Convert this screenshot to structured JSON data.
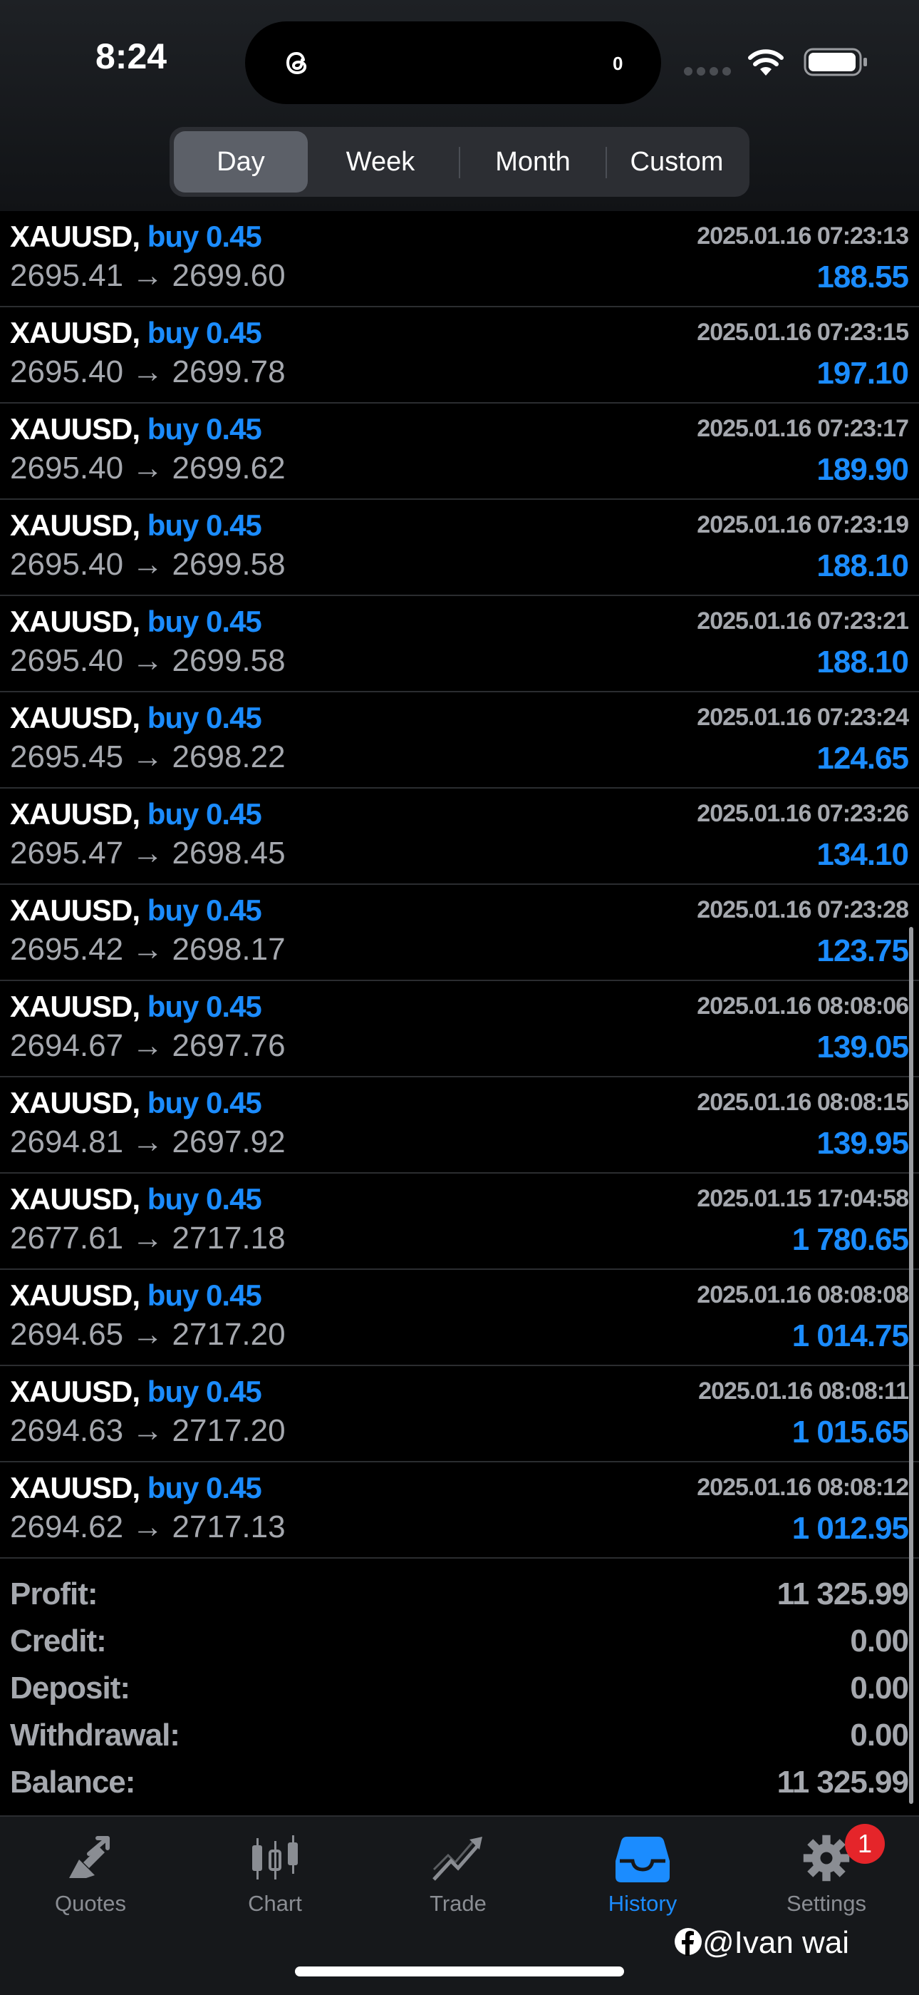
{
  "status_bar": {
    "time": "8:24",
    "island_count": "0"
  },
  "period_tabs": [
    {
      "label": "Day",
      "active": true
    },
    {
      "label": "Week",
      "active": false
    },
    {
      "label": "Month",
      "active": false
    },
    {
      "label": "Custom",
      "active": false
    }
  ],
  "deals": [
    {
      "symbol": "XAUUSD,",
      "action": "buy 0.45",
      "open": "2695.41",
      "close": "2699.60",
      "time": "2025.01.16 07:23:13",
      "profit": "188.55"
    },
    {
      "symbol": "XAUUSD,",
      "action": "buy 0.45",
      "open": "2695.40",
      "close": "2699.78",
      "time": "2025.01.16 07:23:15",
      "profit": "197.10"
    },
    {
      "symbol": "XAUUSD,",
      "action": "buy 0.45",
      "open": "2695.40",
      "close": "2699.62",
      "time": "2025.01.16 07:23:17",
      "profit": "189.90"
    },
    {
      "symbol": "XAUUSD,",
      "action": "buy 0.45",
      "open": "2695.40",
      "close": "2699.58",
      "time": "2025.01.16 07:23:19",
      "profit": "188.10"
    },
    {
      "symbol": "XAUUSD,",
      "action": "buy 0.45",
      "open": "2695.40",
      "close": "2699.58",
      "time": "2025.01.16 07:23:21",
      "profit": "188.10"
    },
    {
      "symbol": "XAUUSD,",
      "action": "buy 0.45",
      "open": "2695.45",
      "close": "2698.22",
      "time": "2025.01.16 07:23:24",
      "profit": "124.65"
    },
    {
      "symbol": "XAUUSD,",
      "action": "buy 0.45",
      "open": "2695.47",
      "close": "2698.45",
      "time": "2025.01.16 07:23:26",
      "profit": "134.10"
    },
    {
      "symbol": "XAUUSD,",
      "action": "buy 0.45",
      "open": "2695.42",
      "close": "2698.17",
      "time": "2025.01.16 07:23:28",
      "profit": "123.75"
    },
    {
      "symbol": "XAUUSD,",
      "action": "buy 0.45",
      "open": "2694.67",
      "close": "2697.76",
      "time": "2025.01.16 08:08:06",
      "profit": "139.05"
    },
    {
      "symbol": "XAUUSD,",
      "action": "buy 0.45",
      "open": "2694.81",
      "close": "2697.92",
      "time": "2025.01.16 08:08:15",
      "profit": "139.95"
    },
    {
      "symbol": "XAUUSD,",
      "action": "buy 0.45",
      "open": "2677.61",
      "close": "2717.18",
      "time": "2025.01.15 17:04:58",
      "profit": "1 780.65"
    },
    {
      "symbol": "XAUUSD,",
      "action": "buy 0.45",
      "open": "2694.65",
      "close": "2717.20",
      "time": "2025.01.16 08:08:08",
      "profit": "1 014.75"
    },
    {
      "symbol": "XAUUSD,",
      "action": "buy 0.45",
      "open": "2694.63",
      "close": "2717.20",
      "time": "2025.01.16 08:08:11",
      "profit": "1 015.65"
    },
    {
      "symbol": "XAUUSD,",
      "action": "buy 0.45",
      "open": "2694.62",
      "close": "2717.13",
      "time": "2025.01.16 08:08:12",
      "profit": "1 012.95"
    }
  ],
  "arrow": "→",
  "summary": [
    {
      "label": "Profit:",
      "value": "11 325.99"
    },
    {
      "label": "Credit:",
      "value": "0.00"
    },
    {
      "label": "Deposit:",
      "value": "0.00"
    },
    {
      "label": "Withdrawal:",
      "value": "0.00"
    },
    {
      "label": "Balance:",
      "value": "11 325.99"
    }
  ],
  "tabbar": [
    {
      "label": "Quotes",
      "icon": "quotes-icon",
      "active": false
    },
    {
      "label": "Chart",
      "icon": "candlestick-icon",
      "active": false
    },
    {
      "label": "Trade",
      "icon": "trade-icon",
      "active": false
    },
    {
      "label": "History",
      "icon": "inbox-icon",
      "active": true
    },
    {
      "label": "Settings",
      "icon": "gear-icon",
      "active": false
    }
  ],
  "settings_badge": "1",
  "watermark": "@Ivan wai",
  "colors": {
    "accent": "#1b8cff",
    "background": "#000000",
    "muted_text": "#a5a8ae",
    "badge": "#e5252a"
  }
}
